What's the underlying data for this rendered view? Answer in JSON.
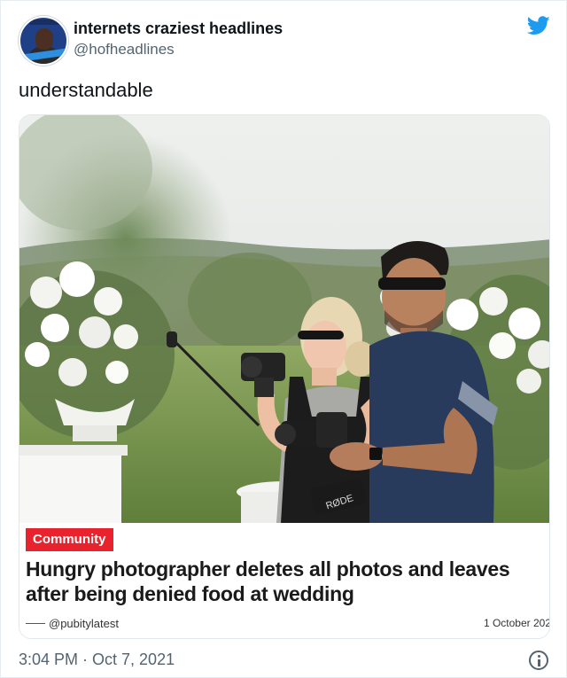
{
  "tweet": {
    "author_name": "internets craziest headlines",
    "author_handle": "@hofheadlines",
    "text": "understandable",
    "timestamp": "3:04 PM · Oct 7, 2021",
    "brand_color": "#1d9bf0"
  },
  "article": {
    "badge": "Community",
    "badge_color": "#e8232d",
    "headline": "Hungry photographer deletes all photos and leaves after being denied food at wedding",
    "byline": "@pubitylatest",
    "date": "1 October 202",
    "mic_brand": "RØDE"
  }
}
